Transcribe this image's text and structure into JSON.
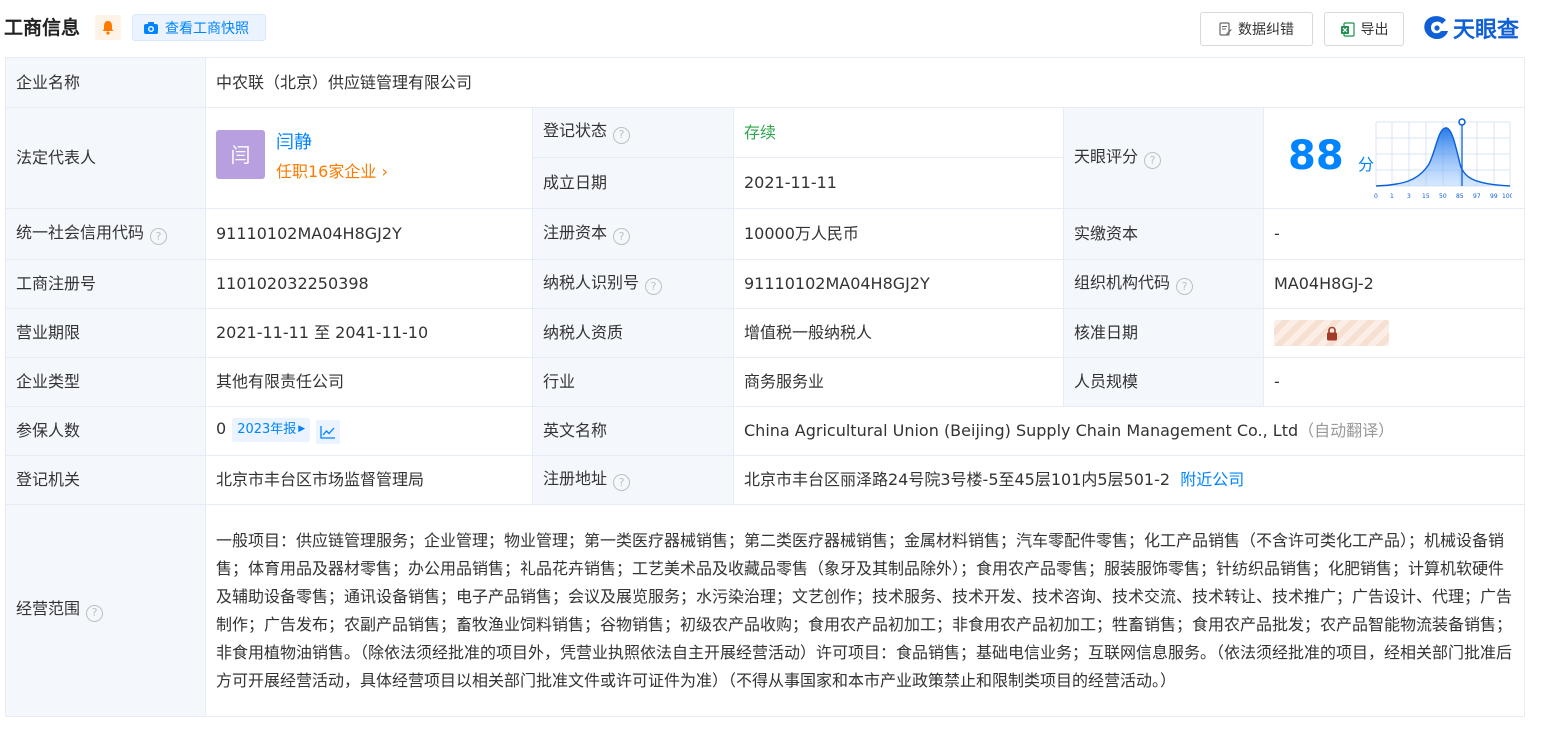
{
  "header": {
    "title": "工商信息",
    "snapshot_label": "查看工商快照",
    "correct_label": "数据纠错",
    "export_label": "导出",
    "logo_text": "天眼查"
  },
  "labels": {
    "company_name": "企业名称",
    "legal_rep": "法定代表人",
    "reg_status": "登记状态",
    "est_date": "成立日期",
    "tianyan_score": "天眼评分",
    "credit_code": "统一社会信用代码",
    "reg_capital": "注册资本",
    "paid_capital": "实缴资本",
    "reg_no": "工商注册号",
    "taxpayer_id": "纳税人识别号",
    "org_code": "组织机构代码",
    "biz_term": "营业期限",
    "taxpayer_type": "纳税人资质",
    "approval_date": "核准日期",
    "company_type": "企业类型",
    "industry": "行业",
    "staff_size": "人员规模",
    "insured": "参保人数",
    "english_name": "英文名称",
    "reg_authority": "登记机关",
    "reg_address": "注册地址",
    "biz_scope": "经营范围"
  },
  "values": {
    "company_name": "中农联（北京）供应链管理有限公司",
    "legal_rep_avatar": "闫",
    "legal_rep_name": "闫静",
    "legal_rep_link": "任职16家企业",
    "reg_status": "存续",
    "est_date": "2021-11-11",
    "score": "88",
    "score_unit": "分",
    "credit_code": "91110102MA04H8GJ2Y",
    "reg_capital": "10000万人民币",
    "paid_capital": "-",
    "reg_no": "110102032250398",
    "taxpayer_id": "91110102MA04H8GJ2Y",
    "org_code": "MA04H8GJ-2",
    "biz_term": "2021-11-11 至 2041-11-10",
    "taxpayer_type": "增值税一般纳税人",
    "company_type": "其他有限责任公司",
    "industry": "商务服务业",
    "staff_size": "-",
    "insured": "0",
    "insured_year": "2023年报",
    "english_name": "China Agricultural Union (Beijing) Supply Chain Management Co., Ltd",
    "english_note": "（自动翻译）",
    "reg_authority": "北京市丰台区市场监督管理局",
    "reg_address": "北京市丰台区丽泽路24号院3号楼-5至45层101内5层501-2",
    "nearby_link": "附近公司",
    "biz_scope": "一般项目：供应链管理服务；企业管理；物业管理；第一类医疗器械销售；第二类医疗器械销售；金属材料销售；汽车零配件零售；化工产品销售（不含许可类化工产品）；机械设备销售；体育用品及器材零售；办公用品销售；礼品花卉销售；工艺美术品及收藏品零售（象牙及其制品除外）；食用农产品零售；服装服饰零售；针纺织品销售；化肥销售；计算机软硬件及辅助设备零售；通讯设备销售；电子产品销售；会议及展览服务；水污染治理；文艺创作；技术服务、技术开发、技术咨询、技术交流、技术转让、技术推广；广告设计、代理；广告制作；广告发布；农副产品销售；畜牧渔业饲料销售；谷物销售；初级农产品收购；食用农产品初加工；非食用农产品初加工；牲畜销售；食用农产品批发；农产品智能物流装备销售；非食用植物油销售。（除依法须经批准的项目外，凭营业执照依法自主开展经营活动）许可项目：食品销售；基础电信业务；互联网信息服务。（依法须经批准的项目，经相关部门批准后方可开展经营活动，具体经营项目以相关部门批准文件或许可证件为准）（不得从事国家和本市产业政策禁止和限制类项目的经营活动。）"
  },
  "score_chart": {
    "ticks": [
      "0",
      "1",
      "3",
      "15",
      "50",
      "85",
      "97",
      "99",
      "100"
    ],
    "marker": 88
  },
  "colors": {
    "accent": "#0084ff",
    "status_green": "#2fa54d",
    "orange": "#ff7a00",
    "label_bg": "#f4f8fd",
    "border": "#e6ecf5"
  }
}
